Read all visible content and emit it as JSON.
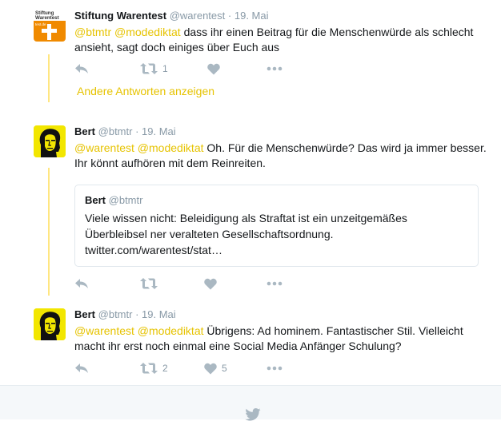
{
  "tweets": [
    {
      "name": "Stiftung Warentest",
      "handle": "@warentest",
      "separator": "·",
      "date": "19. Mai",
      "mentions": "@btmtr @modediktat",
      "text": " dass ihr einen Beitrag für die Menschenwürde als schlecht ansieht, sagt doch einiges über Euch aus",
      "retweet_count": "1",
      "like_count": ""
    },
    {
      "name": "Bert",
      "handle": "@btmtr",
      "separator": "·",
      "date": "19. Mai",
      "mentions": "@warentest @modediktat",
      "text": " Oh. Für die Menschenwürde? Das wird ja immer besser. Ihr könnt aufhören mit dem Reinreiten.",
      "retweet_count": "",
      "like_count": ""
    },
    {
      "name": "Bert",
      "handle": "@btmtr",
      "separator": "·",
      "date": "19. Mai",
      "mentions": "@warentest @modediktat",
      "text": " Übrigens: Ad hominem. Fantastischer Stil. Vielleicht macht ihr erst noch einmal eine Social Media Anfänger Schulung?",
      "retweet_count": "2",
      "like_count": "5"
    }
  ],
  "more_replies_label": "Andere Antworten anzeigen",
  "quote": {
    "name": "Bert",
    "handle": "@btmtr",
    "text": "Viele wissen nicht: Beleidigung als Straftat ist ein unzeitgemäßes Überbleibsel ner veralteten Gesellschaftsordnung.",
    "link": "twitter.com/warentest/stat…"
  },
  "logo": {
    "line1": "Stiftung",
    "line2": "Warentest",
    "line3": "test.de"
  },
  "icons": {
    "reply": "reply-icon",
    "retweet": "retweet-icon",
    "like": "heart-icon",
    "more": "more-icon",
    "footer": "twitter-bird-icon"
  },
  "colors": {
    "accent": "#e6c300",
    "thread_line": "#ffe681",
    "icon_gray": "#aab8c2",
    "text_secondary": "#8899a6",
    "logo_orange": "#f08a00"
  }
}
